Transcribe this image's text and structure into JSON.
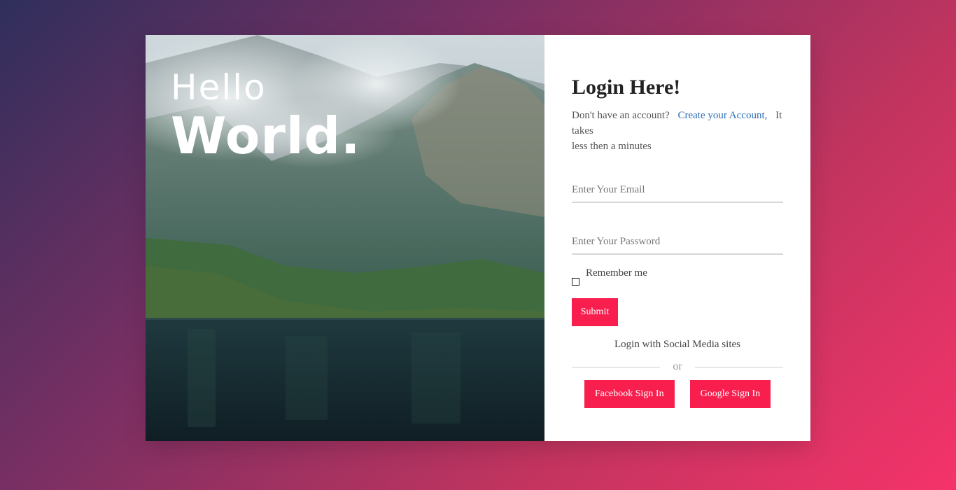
{
  "hero": {
    "line1": "Hello",
    "line2": "World."
  },
  "login": {
    "title": "Login Here!",
    "prompt": "Don't have an account?",
    "create_link": "Create your Account,",
    "takes": "It takes",
    "minutes": "less then a minutes",
    "email_placeholder": "Enter Your Email",
    "password_placeholder": "Enter Your Password",
    "remember_label": "Remember me",
    "submit_label": "Submit",
    "social_label": "Login with Social Media sites",
    "or_label": "or",
    "facebook_label": "Facebook Sign In",
    "google_label": "Google Sign In"
  },
  "colors": {
    "accent": "#f81f4e",
    "link": "#2f6fb5",
    "bg_start": "#2f2f5c",
    "bg_end": "#f5336a"
  }
}
